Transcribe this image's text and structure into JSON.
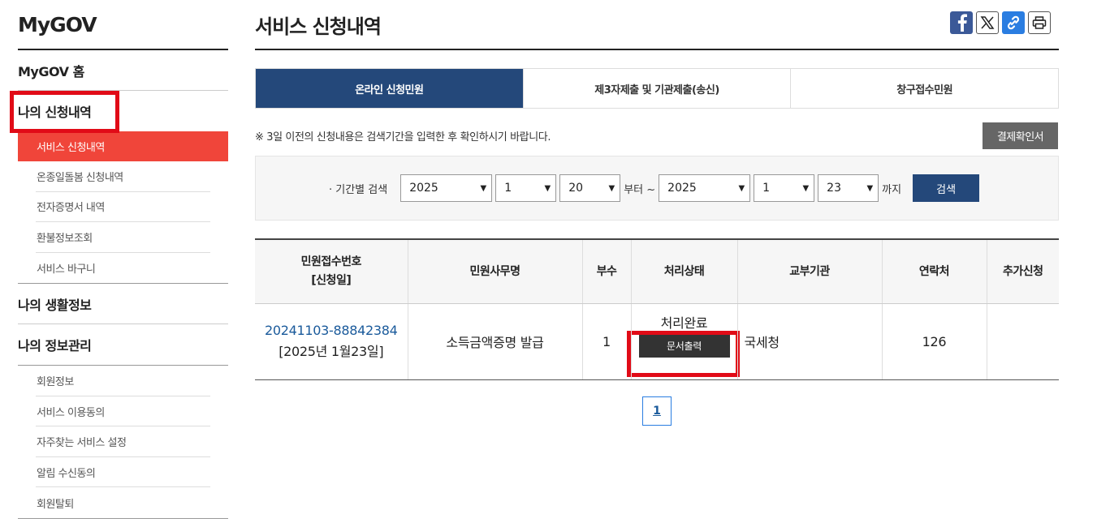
{
  "sidebar": {
    "brand": "MyGOV",
    "home": "MyGOV 홈",
    "my_applications": "나의 신청내역",
    "applications_items": [
      {
        "label": "서비스 신청내역"
      },
      {
        "label": "온종일돌봄 신청내역"
      },
      {
        "label": "전자증명서 내역"
      },
      {
        "label": "환불정보조회"
      },
      {
        "label": "서비스 바구니"
      }
    ],
    "my_life_info": "나의 생활정보",
    "my_info": "나의 정보관리",
    "info_items": [
      {
        "label": "회원정보"
      },
      {
        "label": "서비스 이용동의"
      },
      {
        "label": "자주찾는 서비스 설정"
      },
      {
        "label": "알림 수신동의"
      },
      {
        "label": "회원탈퇴"
      }
    ]
  },
  "page": {
    "title": "서비스 신청내역",
    "share_icons": [
      "facebook-icon",
      "x-icon",
      "link-icon",
      "print-icon"
    ]
  },
  "tabs": [
    {
      "label": "온라인 신청민원"
    },
    {
      "label": "제3자제출 및 기관제출(송신)"
    },
    {
      "label": "창구접수민원"
    }
  ],
  "notice": "※ 3일 이전의 신청내용은 검색기간을 입력한 후 확인하시기 바랍니다.",
  "payment_button": "결제확인서",
  "search": {
    "label": "· 기간별 검색",
    "from_year": "2025",
    "from_month": "1",
    "from_day": "20",
    "from_suffix": "부터 ~",
    "to_year": "2025",
    "to_month": "1",
    "to_day": "23",
    "to_suffix": "까지",
    "button": "검색"
  },
  "table": {
    "headers": {
      "receipt_line1": "민원접수번호",
      "receipt_line2": "[신청일]",
      "name": "민원사무명",
      "copies": "부수",
      "status": "처리상태",
      "org": "교부기관",
      "contact": "연락처",
      "extra": "추가신청"
    },
    "rows": [
      {
        "receipt_no": "20241103-88842384",
        "date": "[2025년 1월23일]",
        "name": "소득금액증명 발급",
        "copies": "1",
        "status": "처리완료",
        "print_button": "문서출력",
        "org": "국세청",
        "contact": "126",
        "extra": ""
      }
    ]
  },
  "pagination": {
    "current": "1"
  },
  "colors": {
    "accent_red": "#f0453a",
    "navy": "#24487a",
    "highlight_box": "#e10b17"
  }
}
